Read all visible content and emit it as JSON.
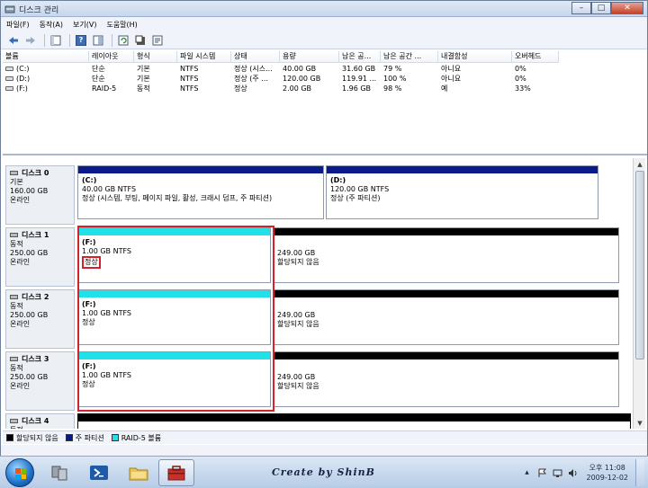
{
  "window": {
    "title": "디스크 관리",
    "controls": {
      "minimize": "–",
      "maximize": "□",
      "close": "✕"
    }
  },
  "menu": [
    "파일(F)",
    "동작(A)",
    "보기(V)",
    "도움말(H)"
  ],
  "toolbar_icons": [
    "back-icon",
    "forward-icon",
    "console-tree-icon",
    "help-icon",
    "show-pane-icon",
    "refresh-icon",
    "properties-icon",
    "settings-icon"
  ],
  "volume_list": {
    "columns": [
      "볼륨",
      "레이아웃",
      "형식",
      "파일 시스템",
      "상태",
      "용량",
      "남은 공...",
      "남은 공간 ...",
      "내결함성",
      "오버헤드"
    ],
    "rows": [
      {
        "volume": "(C:)",
        "layout": "단순",
        "type": "기본",
        "fs": "NTFS",
        "status": "정상 (시스...",
        "capacity": "40.00 GB",
        "free": "31.60 GB",
        "free_pct": "79 %",
        "fault": "아니요",
        "overhead": "0%"
      },
      {
        "volume": "(D:)",
        "layout": "단순",
        "type": "기본",
        "fs": "NTFS",
        "status": "정상 (주 ...",
        "capacity": "120.00 GB",
        "free": "119.91 ...",
        "free_pct": "100 %",
        "fault": "아니요",
        "overhead": "0%"
      },
      {
        "volume": "(F:)",
        "layout": "RAID-5",
        "type": "동적",
        "fs": "NTFS",
        "status": "정상",
        "capacity": "2.00 GB",
        "free": "1.96 GB",
        "free_pct": "98 %",
        "fault": "예",
        "overhead": "33%"
      }
    ]
  },
  "disks": [
    {
      "name": "디스크 0",
      "type": "기본",
      "size": "160.00 GB",
      "state": "온라인",
      "partitions": [
        {
          "kind": "primary",
          "name": "(C:)",
          "detail": "40.00 GB NTFS",
          "status": "정상 (시스템, 부팅, 페이지 파일, 활성, 크래시 덤프, 주 파티션)"
        },
        {
          "kind": "primary",
          "name": "(D:)",
          "detail": "120.00 GB NTFS",
          "status": "정상 (주 파티션)"
        }
      ]
    },
    {
      "name": "디스크 1",
      "type": "동적",
      "size": "250.00 GB",
      "state": "온라인",
      "partitions": [
        {
          "kind": "raid",
          "name": "(F:)",
          "detail": "1.00 GB NTFS",
          "status": "정상"
        },
        {
          "kind": "unalloc",
          "name": "",
          "detail": "249.00 GB",
          "status": "할당되지 않음"
        }
      ]
    },
    {
      "name": "디스크 2",
      "type": "동적",
      "size": "250.00 GB",
      "state": "온라인",
      "partitions": [
        {
          "kind": "raid",
          "name": "(F:)",
          "detail": "1.00 GB NTFS",
          "status": "정상"
        },
        {
          "kind": "unalloc",
          "name": "",
          "detail": "249.00 GB",
          "status": "할당되지 않음"
        }
      ]
    },
    {
      "name": "디스크 3",
      "type": "동적",
      "size": "250.00 GB",
      "state": "온라인",
      "partitions": [
        {
          "kind": "raid",
          "name": "(F:)",
          "detail": "1.00 GB NTFS",
          "status": "정상"
        },
        {
          "kind": "unalloc",
          "name": "",
          "detail": "249.00 GB",
          "status": "할당되지 않음"
        }
      ]
    },
    {
      "name": "디스크 4",
      "type": "동적"
    }
  ],
  "legend": [
    {
      "label": "할당되지 않음",
      "color": "#000000"
    },
    {
      "label": "주 파티션",
      "color": "#0a1a8a"
    },
    {
      "label": "RAID-5 볼륨",
      "color": "#20e0e8"
    }
  ],
  "taskbar": {
    "watermark": "Create by ShinB",
    "clock_time": "오후 11:08",
    "clock_date": "2009-12-02",
    "apps": [
      "network-app-icon",
      "powershell-icon",
      "explorer-icon",
      "toolbox-icon"
    ]
  },
  "colors": {
    "highlight": "#d3222b",
    "raid": "#20e0e8",
    "primary": "#0a1a8a",
    "unallocated": "#000000"
  }
}
